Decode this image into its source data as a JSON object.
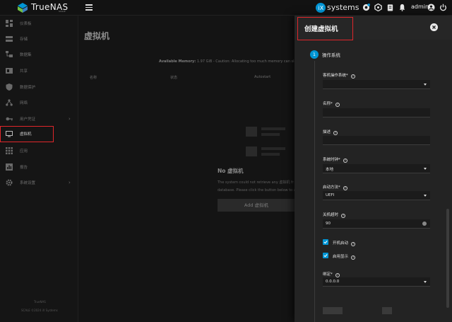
{
  "topbar": {
    "brand": "TrueNAS",
    "brand_sub": "SCALE",
    "vendor": "systems",
    "user": "admin"
  },
  "sidebar": {
    "items": [
      {
        "label": "仪表板",
        "icon": "dashboard-icon"
      },
      {
        "label": "存储",
        "icon": "storage-icon"
      },
      {
        "label": "数据集",
        "icon": "datasets-icon"
      },
      {
        "label": "共享",
        "icon": "shares-icon"
      },
      {
        "label": "数据保护",
        "icon": "data-protection-icon"
      },
      {
        "label": "网络",
        "icon": "network-icon"
      },
      {
        "label": "用户凭证",
        "icon": "key-icon"
      },
      {
        "label": "虚拟机",
        "icon": "monitor-icon"
      },
      {
        "label": "应用",
        "icon": "apps-icon"
      },
      {
        "label": "报告",
        "icon": "reporting-icon"
      },
      {
        "label": "系统设置",
        "icon": "gear-icon"
      }
    ],
    "active_index": 7,
    "footer_line1": "TrueNAS",
    "footer_line2": "SCALE ©2024 iX Systems"
  },
  "main": {
    "title": "虚拟机",
    "memory_label": "Available Memory:",
    "memory_text": "1.97 GiB - Caution: Allocating too much memory can slo",
    "columns": [
      "名称",
      "状态",
      "Autostart"
    ],
    "empty_title": "No 虚拟机",
    "empty_desc_1": "The system could not retrieve any 虚拟机 fr",
    "empty_desc_2": "database. Please click the button below to a",
    "add_button": "Add 虚拟机"
  },
  "panel": {
    "title": "创建虚拟机",
    "step_number": "1",
    "step_label": "操作系统",
    "fields": {
      "guest_os": {
        "label": "客机操作系统*",
        "value": ""
      },
      "name": {
        "label": "名称*",
        "value": ""
      },
      "description": {
        "label": "描述",
        "value": ""
      },
      "clock": {
        "label": "系统时钟*",
        "value": "本地"
      },
      "boot_method": {
        "label": "启动方法*",
        "value": "UEFI"
      },
      "shutdown_timeout": {
        "label": "关机超时",
        "value": "90"
      },
      "bind": {
        "label": "绑定*",
        "value": "0.0.0.0"
      }
    },
    "checkboxes": {
      "autostart": {
        "label": "开机启动",
        "checked": true
      },
      "display": {
        "label": "启用显示",
        "checked": true
      }
    }
  },
  "colors": {
    "accent": "#0095d5",
    "highlight": "#e0262b",
    "panel_bg": "#232323"
  }
}
